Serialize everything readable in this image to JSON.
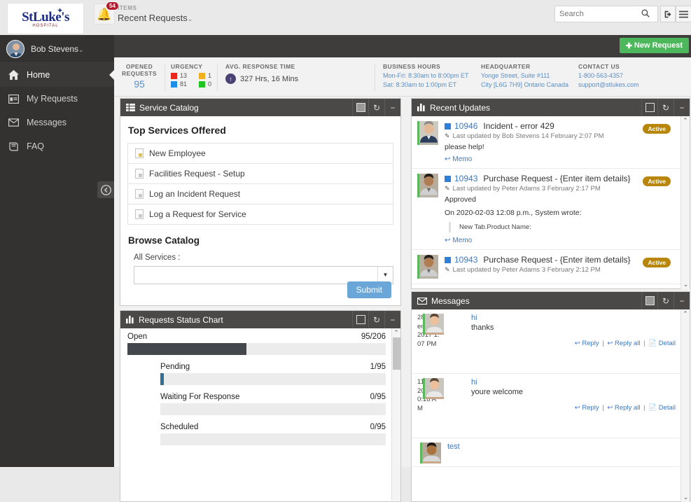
{
  "topbar": {
    "logo_text": "StLuke's",
    "logo_sub": "HOSPITAL",
    "bell_icon": "bell-icon",
    "bell_badge": "54",
    "items_label": "ITEMS",
    "items_title": "Recent Requests",
    "items_caret": "⌄",
    "search_placeholder": "Search",
    "search_value": "",
    "search_icon": "search-icon",
    "logout_icon": "logout-icon",
    "menu_icon": "hamburger-menu-icon"
  },
  "sidebar": {
    "user_name": "Bob Stevens",
    "user_caret": "⌄",
    "collapse_icon": "chevron-left-circle-icon",
    "items": [
      {
        "label": "Home",
        "icon": "home-icon",
        "active": true
      },
      {
        "label": "My Requests",
        "icon": "window-icon",
        "active": false
      },
      {
        "label": "Messages",
        "icon": "envelope-icon",
        "active": false
      },
      {
        "label": "FAQ",
        "icon": "book-icon",
        "active": false
      }
    ]
  },
  "actionbar": {
    "new_request_label": "New Request",
    "new_request_plus": "✚",
    "new_request_color": "#4cb75b"
  },
  "stats": {
    "opened": {
      "head_line1": "OPENED",
      "head_line2": "REQUESTS",
      "value": "95"
    },
    "urgency": {
      "head": "URGENCY",
      "cells": [
        {
          "color": "#e8281e",
          "value": "13"
        },
        {
          "color": "#f2b01e",
          "value": "1"
        },
        {
          "color": "#1e8fe8",
          "value": "81"
        },
        {
          "color": "#21c521",
          "value": "0"
        }
      ]
    },
    "avg_response": {
      "head": "AVG. RESPONSE TIME",
      "icon": "arrow-up-circle-icon",
      "value": "327 Hrs, 16 Mins"
    },
    "business_hours": {
      "head": "BUSINESS HOURS",
      "line1": "Mon-Fri: 8:30am to 8:00pm ET",
      "line2": "Sat: 8:30am to 1:00pm ET"
    },
    "headquarter": {
      "head": "HEADQUARTER",
      "line1": "Yonge Street, Suite #111",
      "line2": "City [L6G 7H9] Ontario Canada"
    },
    "contact": {
      "head": "CONTACT US",
      "line1": "1-800-563-4357",
      "line2": "support@stlukes.com"
    }
  },
  "service_catalog": {
    "panel_title": "Service Catalog",
    "panel_icon": "list-icon",
    "ctrl_maximize": "maximize-icon",
    "ctrl_refresh": "↻",
    "ctrl_minimize": "−",
    "top_services_title": "Top Services Offered",
    "services": [
      {
        "label": "New Employee",
        "icon": "document-icon"
      },
      {
        "label": "Facilities Request - Setup",
        "icon": "document-icon"
      },
      {
        "label": "Log an Incident Request",
        "icon": "document-icon"
      },
      {
        "label": "Log a Request for Service",
        "icon": "document-icon"
      }
    ],
    "browse_title": "Browse Catalog",
    "all_services_label": "All Services :",
    "select_value": "",
    "select_arrow": "▼",
    "submit_label": "Submit"
  },
  "chart_data": {
    "type": "bar",
    "title": "Requests Status Chart",
    "panel_icon": "bar-chart-icon",
    "ctrl_maximize": "maximize-icon",
    "ctrl_refresh": "↻",
    "ctrl_minimize": "−",
    "orientation": "horizontal",
    "categories": [
      "Open",
      "Pending",
      "Waiting For Response",
      "Scheduled"
    ],
    "values": [
      95,
      1,
      0,
      0
    ],
    "totals": [
      206,
      95,
      95,
      95
    ],
    "labels": [
      "95/206",
      "1/95",
      "0/95",
      "0/95"
    ],
    "percents": [
      46.1,
      1.05,
      0,
      0
    ],
    "indent": [
      false,
      true,
      true,
      true
    ],
    "bar_colors": [
      "#44484d",
      "#31708f",
      "#31708f",
      "#31708f"
    ],
    "track_color": "#ececec",
    "xlabel": "",
    "ylabel": "",
    "grid": false,
    "legend": false
  },
  "recent_updates": {
    "panel_title": "Recent Updates",
    "panel_icon": "bar-chart-icon",
    "ctrl_maximize": "maximize-icon",
    "ctrl_refresh": "↻",
    "ctrl_minimize": "−",
    "scroll_up": "⌃",
    "scroll_down": "⌄",
    "items": [
      {
        "id": "10946",
        "subject": "Incident - error 429",
        "meta": "Last updated by Bob Stevens 14 February 2:07 PM",
        "body": "please help!",
        "quote_header": "",
        "quote_body": "",
        "memo": "Memo",
        "badge": "Active",
        "avatar": "avatar-bob-stevens"
      },
      {
        "id": "10943",
        "subject": "Purchase Request - {Enter item details}",
        "meta": "Last updated by Peter Adams 3 February 2:17 PM",
        "body": "Approved",
        "quote_header": "On 2020-02-03 12:08 p.m., System wrote:",
        "quote_body": "New Tab.Product Name:",
        "memo": "Memo",
        "badge": "Active",
        "avatar": "avatar-peter-adams"
      },
      {
        "id": "10943",
        "subject": "Purchase Request - {Enter item details}",
        "meta": "Last updated by Peter Adams 3 February 2:12 PM",
        "body": "",
        "quote_header": "",
        "quote_body": "",
        "memo": "",
        "badge": "Active",
        "avatar": "avatar-peter-adams"
      }
    ]
  },
  "messages": {
    "panel_title": "Messages",
    "panel_icon": "envelope-icon",
    "ctrl_maximize": "maximize-icon",
    "ctrl_refresh": "↻",
    "ctrl_minimize": "−",
    "scroll_up": "⌃",
    "scroll_down": "⌄",
    "reply_label": "Reply",
    "reply_all_label": "Reply all",
    "detail_label": "Detail",
    "items": [
      {
        "subject": "hi",
        "preview": "thanks",
        "date": "28 September, 2017 1:07 PM",
        "avatar": "avatar-sender-1"
      },
      {
        "subject": "hi",
        "preview": "youre welcome",
        "date": "11 July, 2017 10:16 AM",
        "avatar": "avatar-sender-1"
      },
      {
        "subject": "test",
        "preview": "",
        "date": "",
        "avatar": "avatar-sender-2"
      }
    ]
  }
}
